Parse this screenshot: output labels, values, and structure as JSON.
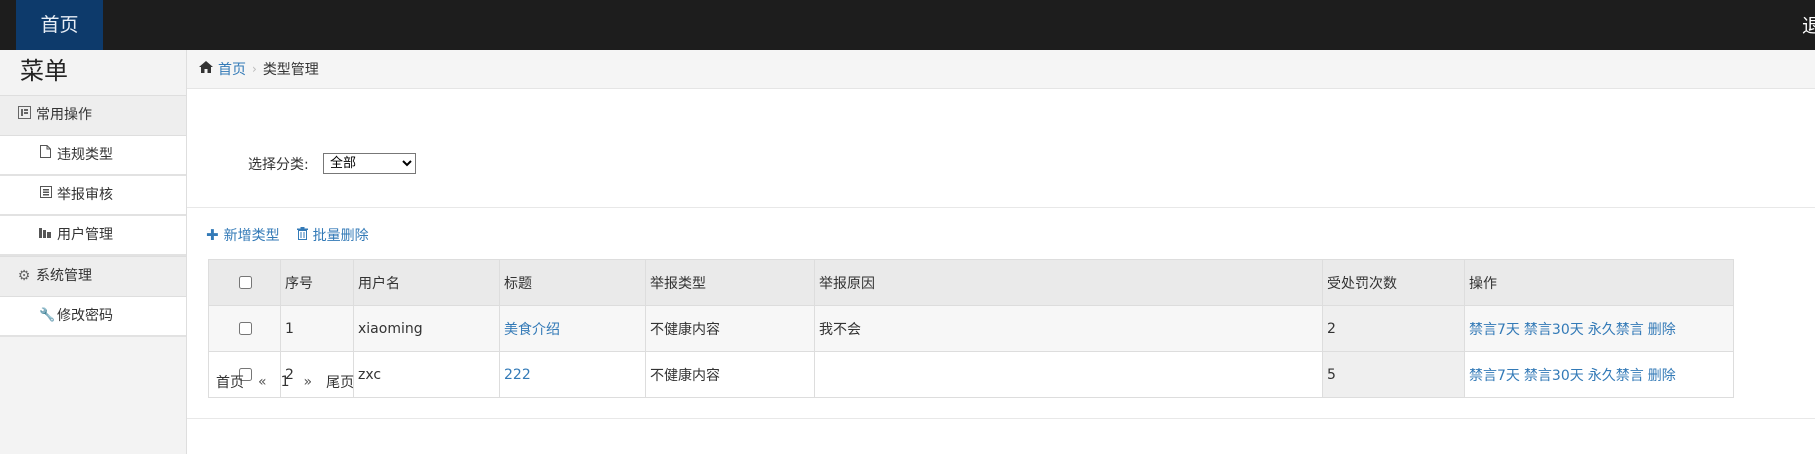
{
  "topbar": {
    "home_label": "首页",
    "right_label": "退"
  },
  "sidebar": {
    "title": "菜单",
    "groups": [
      {
        "label": "常用操作",
        "icon": "list-icon",
        "items": [
          {
            "label": "违规类型",
            "icon": "file-icon"
          },
          {
            "label": "举报审核",
            "icon": "list-alt-icon"
          },
          {
            "label": "用户管理",
            "icon": "books-icon"
          }
        ]
      },
      {
        "label": "系统管理",
        "icon": "gear-icon",
        "items": [
          {
            "label": "修改密码",
            "icon": "wrench-icon"
          }
        ]
      }
    ]
  },
  "breadcrumb": {
    "home": "首页",
    "current": "类型管理"
  },
  "filter": {
    "label": "选择分类:",
    "selected": "全部"
  },
  "actions": {
    "add": "新增类型",
    "batch_delete": "批量删除"
  },
  "table": {
    "headers": [
      "序号",
      "用户名",
      "标题",
      "举报类型",
      "举报原因",
      "受处罚次数",
      "操作"
    ],
    "rows": [
      {
        "no": "1",
        "user": "xiaoming",
        "title": "美食介绍",
        "type": "不健康内容",
        "reason": "我不会",
        "count": "2"
      },
      {
        "no": "2",
        "user": "zxc",
        "title": "222",
        "type": "不健康内容",
        "reason": "",
        "count": "5"
      }
    ],
    "ops": [
      "禁言7天",
      "禁言30天",
      "永久禁言",
      "删除"
    ]
  },
  "pager": {
    "first": "首页",
    "prev": "«",
    "page": "1",
    "next": "»",
    "last": "尾页"
  },
  "colors": {
    "topbar": "#1d1d1d",
    "home_tab": "#0d3a6b",
    "link": "#337ab7"
  }
}
